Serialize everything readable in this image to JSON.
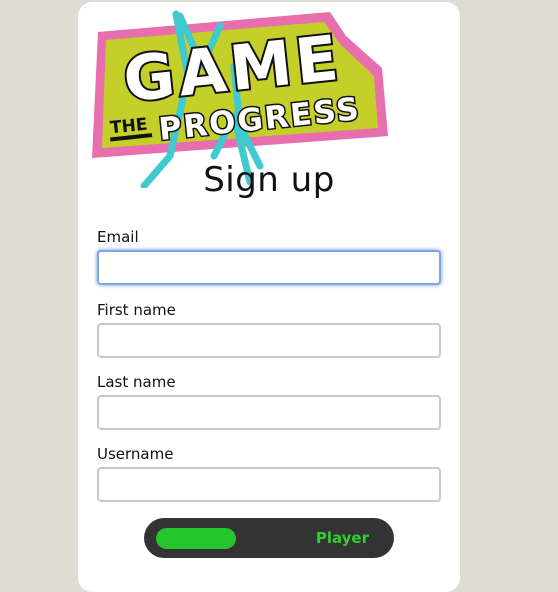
{
  "logo": {
    "word_top": "GAME",
    "word_small": "THE",
    "word_bottom": "PROGRESS",
    "colors": {
      "pink": "#e86fae",
      "lime": "#c4cf2a",
      "cyan": "#3fc9d1",
      "ink": "#111111"
    }
  },
  "form": {
    "title": "Sign up",
    "fields": [
      {
        "label": "Email",
        "value": "",
        "placeholder": ""
      },
      {
        "label": "First name",
        "value": "",
        "placeholder": ""
      },
      {
        "label": "Last name",
        "value": "",
        "placeholder": ""
      },
      {
        "label": "Username",
        "value": "",
        "placeholder": ""
      }
    ],
    "role_toggle": {
      "label": "Player",
      "color": "#2fcf33"
    }
  }
}
